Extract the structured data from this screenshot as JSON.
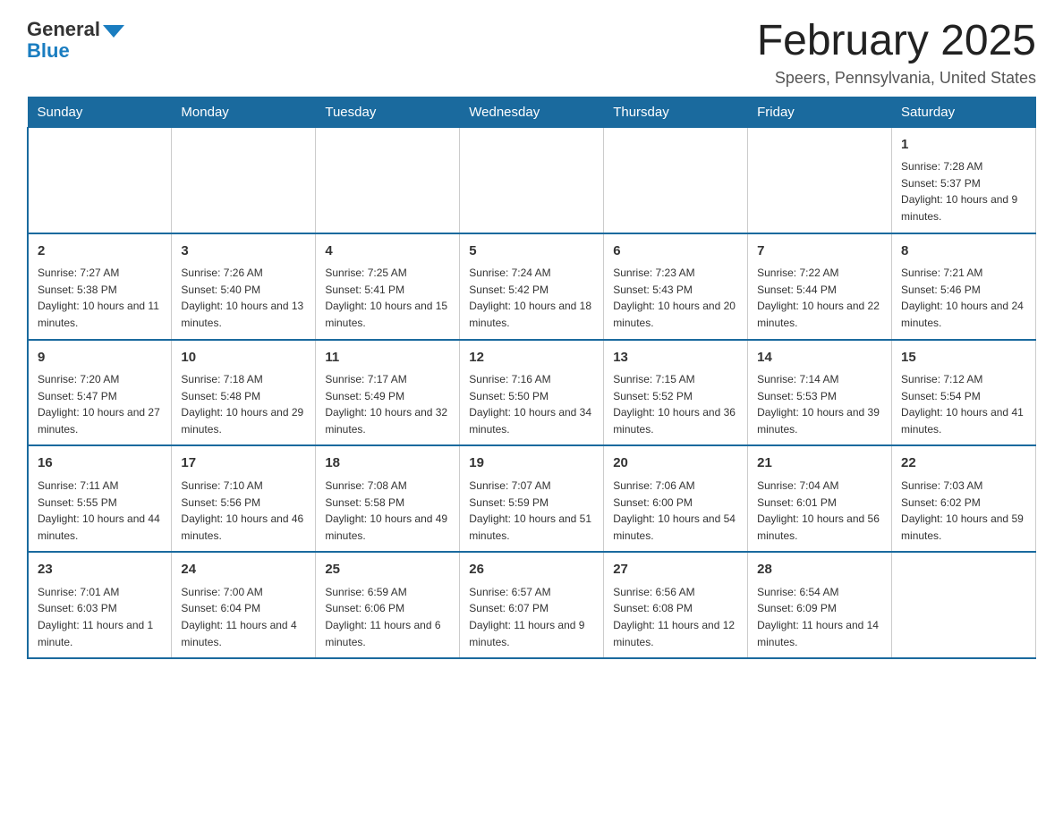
{
  "logo": {
    "general": "General",
    "blue": "Blue"
  },
  "title": "February 2025",
  "subtitle": "Speers, Pennsylvania, United States",
  "weekdays": [
    "Sunday",
    "Monday",
    "Tuesday",
    "Wednesday",
    "Thursday",
    "Friday",
    "Saturday"
  ],
  "weeks": [
    [
      {
        "day": "",
        "info": ""
      },
      {
        "day": "",
        "info": ""
      },
      {
        "day": "",
        "info": ""
      },
      {
        "day": "",
        "info": ""
      },
      {
        "day": "",
        "info": ""
      },
      {
        "day": "",
        "info": ""
      },
      {
        "day": "1",
        "info": "Sunrise: 7:28 AM\nSunset: 5:37 PM\nDaylight: 10 hours and 9 minutes."
      }
    ],
    [
      {
        "day": "2",
        "info": "Sunrise: 7:27 AM\nSunset: 5:38 PM\nDaylight: 10 hours and 11 minutes."
      },
      {
        "day": "3",
        "info": "Sunrise: 7:26 AM\nSunset: 5:40 PM\nDaylight: 10 hours and 13 minutes."
      },
      {
        "day": "4",
        "info": "Sunrise: 7:25 AM\nSunset: 5:41 PM\nDaylight: 10 hours and 15 minutes."
      },
      {
        "day": "5",
        "info": "Sunrise: 7:24 AM\nSunset: 5:42 PM\nDaylight: 10 hours and 18 minutes."
      },
      {
        "day": "6",
        "info": "Sunrise: 7:23 AM\nSunset: 5:43 PM\nDaylight: 10 hours and 20 minutes."
      },
      {
        "day": "7",
        "info": "Sunrise: 7:22 AM\nSunset: 5:44 PM\nDaylight: 10 hours and 22 minutes."
      },
      {
        "day": "8",
        "info": "Sunrise: 7:21 AM\nSunset: 5:46 PM\nDaylight: 10 hours and 24 minutes."
      }
    ],
    [
      {
        "day": "9",
        "info": "Sunrise: 7:20 AM\nSunset: 5:47 PM\nDaylight: 10 hours and 27 minutes."
      },
      {
        "day": "10",
        "info": "Sunrise: 7:18 AM\nSunset: 5:48 PM\nDaylight: 10 hours and 29 minutes."
      },
      {
        "day": "11",
        "info": "Sunrise: 7:17 AM\nSunset: 5:49 PM\nDaylight: 10 hours and 32 minutes."
      },
      {
        "day": "12",
        "info": "Sunrise: 7:16 AM\nSunset: 5:50 PM\nDaylight: 10 hours and 34 minutes."
      },
      {
        "day": "13",
        "info": "Sunrise: 7:15 AM\nSunset: 5:52 PM\nDaylight: 10 hours and 36 minutes."
      },
      {
        "day": "14",
        "info": "Sunrise: 7:14 AM\nSunset: 5:53 PM\nDaylight: 10 hours and 39 minutes."
      },
      {
        "day": "15",
        "info": "Sunrise: 7:12 AM\nSunset: 5:54 PM\nDaylight: 10 hours and 41 minutes."
      }
    ],
    [
      {
        "day": "16",
        "info": "Sunrise: 7:11 AM\nSunset: 5:55 PM\nDaylight: 10 hours and 44 minutes."
      },
      {
        "day": "17",
        "info": "Sunrise: 7:10 AM\nSunset: 5:56 PM\nDaylight: 10 hours and 46 minutes."
      },
      {
        "day": "18",
        "info": "Sunrise: 7:08 AM\nSunset: 5:58 PM\nDaylight: 10 hours and 49 minutes."
      },
      {
        "day": "19",
        "info": "Sunrise: 7:07 AM\nSunset: 5:59 PM\nDaylight: 10 hours and 51 minutes."
      },
      {
        "day": "20",
        "info": "Sunrise: 7:06 AM\nSunset: 6:00 PM\nDaylight: 10 hours and 54 minutes."
      },
      {
        "day": "21",
        "info": "Sunrise: 7:04 AM\nSunset: 6:01 PM\nDaylight: 10 hours and 56 minutes."
      },
      {
        "day": "22",
        "info": "Sunrise: 7:03 AM\nSunset: 6:02 PM\nDaylight: 10 hours and 59 minutes."
      }
    ],
    [
      {
        "day": "23",
        "info": "Sunrise: 7:01 AM\nSunset: 6:03 PM\nDaylight: 11 hours and 1 minute."
      },
      {
        "day": "24",
        "info": "Sunrise: 7:00 AM\nSunset: 6:04 PM\nDaylight: 11 hours and 4 minutes."
      },
      {
        "day": "25",
        "info": "Sunrise: 6:59 AM\nSunset: 6:06 PM\nDaylight: 11 hours and 6 minutes."
      },
      {
        "day": "26",
        "info": "Sunrise: 6:57 AM\nSunset: 6:07 PM\nDaylight: 11 hours and 9 minutes."
      },
      {
        "day": "27",
        "info": "Sunrise: 6:56 AM\nSunset: 6:08 PM\nDaylight: 11 hours and 12 minutes."
      },
      {
        "day": "28",
        "info": "Sunrise: 6:54 AM\nSunset: 6:09 PM\nDaylight: 11 hours and 14 minutes."
      },
      {
        "day": "",
        "info": ""
      }
    ]
  ]
}
